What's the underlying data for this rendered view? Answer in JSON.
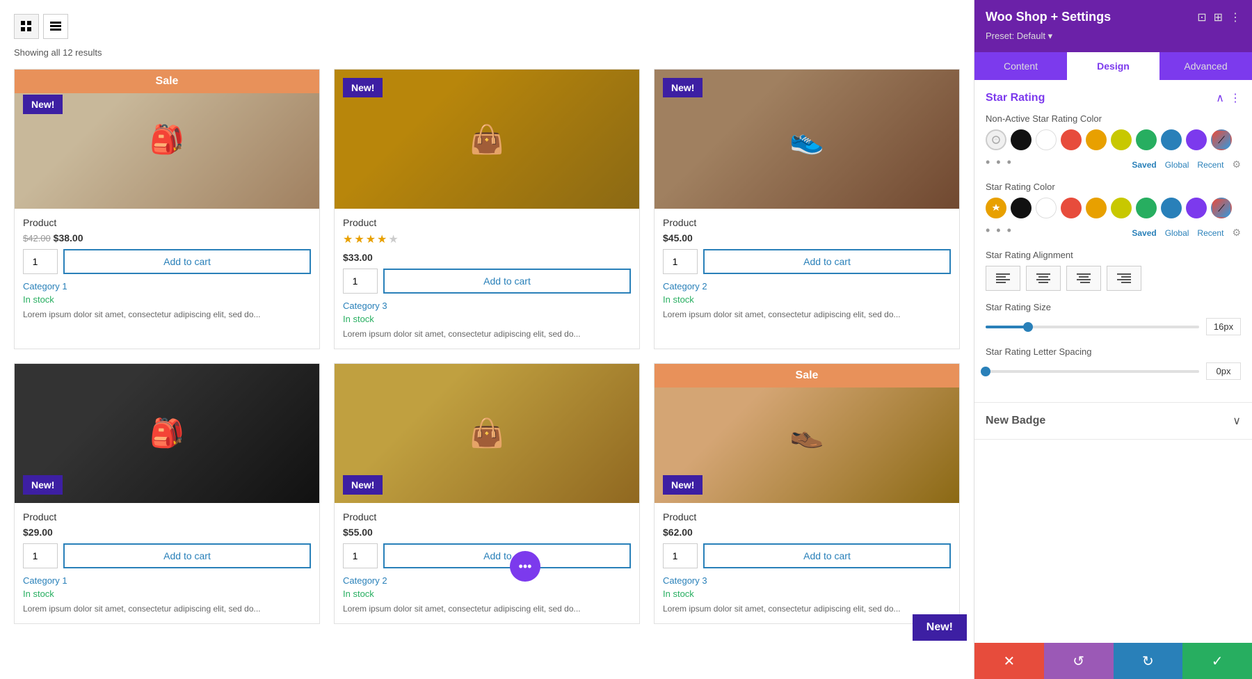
{
  "shop": {
    "results_count": "Showing all 12 results",
    "view_grid_label": "Grid view",
    "view_list_label": "List view",
    "products": [
      {
        "id": 1,
        "title": "Product",
        "badge": "New!",
        "badge_type": "sale_plus_new",
        "sale_label": "Sale",
        "price_old": "$42.00",
        "price_new": "$38.00",
        "has_rating": false,
        "stars": 0,
        "qty": 1,
        "add_to_cart": "Add to cart",
        "category": "Category 1",
        "in_stock": "In stock",
        "description": "Lorem ipsum dolor sit amet, consectetur adipiscing elit, sed do...",
        "img_type": "wallet"
      },
      {
        "id": 2,
        "title": "Product",
        "badge": "New!",
        "badge_type": "new_only",
        "sale_label": "",
        "price_old": "",
        "price_new": "$33.00",
        "has_rating": true,
        "stars": 4,
        "qty": 1,
        "add_to_cart": "Add to cart",
        "category": "Category 3",
        "in_stock": "In stock",
        "description": "Lorem ipsum dolor sit amet, consectetur adipiscing elit, sed do...",
        "img_type": "bag"
      },
      {
        "id": 3,
        "title": "Product",
        "badge": "New!",
        "badge_type": "new_only",
        "sale_label": "",
        "price_old": "",
        "price_new": "$45.00",
        "has_rating": false,
        "stars": 0,
        "qty": 1,
        "add_to_cart": "Add to cart",
        "category": "Category 2",
        "in_stock": "In stock",
        "description": "Lorem ipsum dolor sit amet, consectetur adipiscing elit, sed do...",
        "img_type": "shoes"
      },
      {
        "id": 4,
        "title": "Product",
        "badge": "New!",
        "badge_type": "new_bottom",
        "sale_label": "",
        "price_old": "",
        "price_new": "$29.00",
        "has_rating": false,
        "stars": 0,
        "qty": 1,
        "add_to_cart": "Add to cart",
        "category": "Category 1",
        "in_stock": "In stock",
        "description": "Lorem ipsum dolor sit amet, consectetur adipiscing elit, sed do...",
        "img_type": "dark1"
      },
      {
        "id": 5,
        "title": "Product",
        "badge": "New!",
        "badge_type": "new_bottom",
        "sale_label": "",
        "price_old": "",
        "price_new": "$55.00",
        "has_rating": false,
        "stars": 0,
        "qty": 1,
        "add_to_cart": "Add to cart",
        "category": "Category 2",
        "in_stock": "In stock",
        "description": "Lorem ipsum dolor sit amet, consectetur adipiscing elit, sed do...",
        "img_type": "bag2"
      },
      {
        "id": 6,
        "title": "Product",
        "badge": "New!",
        "badge_type": "sale_plus_new_bottom",
        "sale_label": "Sale",
        "price_old": "",
        "price_new": "$62.00",
        "has_rating": false,
        "stars": 0,
        "qty": 1,
        "add_to_cart": "Add to cart",
        "category": "Category 3",
        "in_stock": "In stock",
        "description": "Lorem ipsum dolor sit amet, consectetur adipiscing elit, sed do...",
        "img_type": "shoes2"
      }
    ]
  },
  "settings": {
    "title": "Woo Shop + Settings",
    "preset_label": "Preset: Default",
    "preset_arrow": "▾",
    "tabs": [
      {
        "id": "content",
        "label": "Content"
      },
      {
        "id": "design",
        "label": "Design"
      },
      {
        "id": "advanced",
        "label": "Advanced"
      }
    ],
    "active_tab": "design",
    "star_rating": {
      "section_title": "Star Rating",
      "non_active_label": "Non-Active Star Rating Color",
      "active_label": "Star Rating Color",
      "color_tabs": [
        "Saved",
        "Global",
        "Recent"
      ],
      "swatches": [
        "#e0e0e0_selected",
        "#111111",
        "#ffffff",
        "#e74c3c",
        "#e8a000",
        "#c8c800",
        "#27ae60",
        "#2980b9",
        "#7c3aed",
        "#gradient"
      ],
      "alignment_label": "Star Rating Alignment",
      "alignments": [
        "left",
        "center-left",
        "center-right",
        "right"
      ],
      "size_label": "Star Rating Size",
      "size_value": "16px",
      "size_percent": 20,
      "letter_spacing_label": "Star Rating Letter Spacing",
      "letter_spacing_value": "0px",
      "letter_spacing_percent": 0
    },
    "new_badge": {
      "section_title": "New Badge"
    },
    "toolbar": {
      "cancel_icon": "✕",
      "undo_icon": "↺",
      "redo_icon": "↻",
      "save_icon": "✓"
    }
  },
  "floating": {
    "dots_icon": "•••",
    "new_badge_label": "New!"
  }
}
